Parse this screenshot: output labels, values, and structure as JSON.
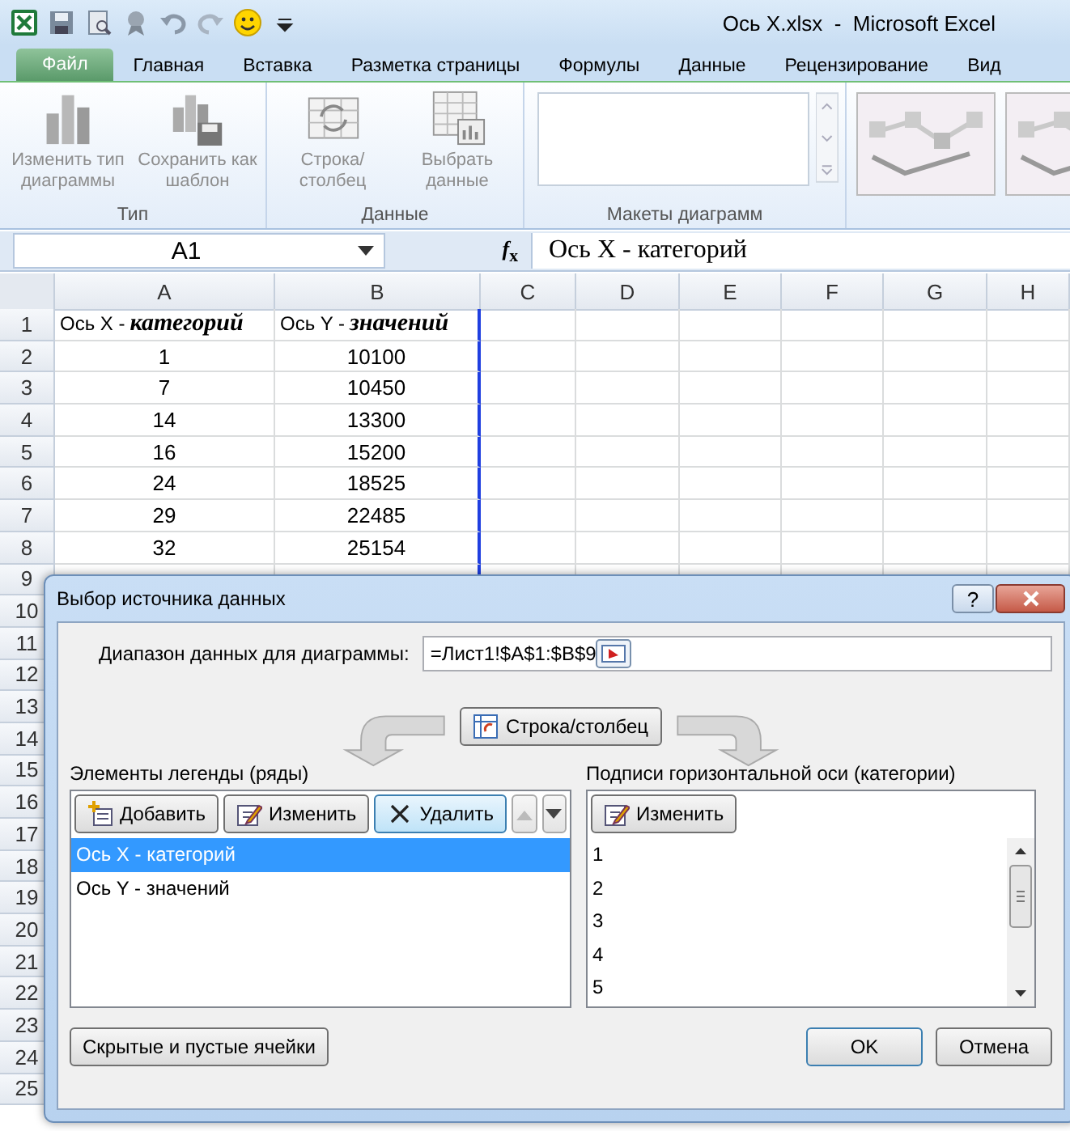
{
  "window": {
    "title": "Ось X.xlsx  -  Microsoft Excel"
  },
  "ribbon_tabs": [
    {
      "label": "Файл",
      "kind": "file",
      "selected": false
    },
    {
      "label": "Главная",
      "kind": "tab",
      "selected": false
    },
    {
      "label": "Вставка",
      "kind": "tab",
      "selected": false
    },
    {
      "label": "Разметка страницы",
      "kind": "tab",
      "selected": false
    },
    {
      "label": "Формулы",
      "kind": "tab",
      "selected": false
    },
    {
      "label": "Данные",
      "kind": "tab",
      "selected": false
    },
    {
      "label": "Рецензирование",
      "kind": "tab",
      "selected": false
    },
    {
      "label": "Вид",
      "kind": "tab",
      "selected": false
    }
  ],
  "ribbon_groups": [
    {
      "label": "Тип",
      "kind": "buttons",
      "buttons": [
        {
          "label": "Изменить тип диаграммы",
          "disabled": true
        },
        {
          "label": "Сохранить как шаблон",
          "disabled": true
        }
      ]
    },
    {
      "label": "Данные",
      "kind": "buttons",
      "buttons": [
        {
          "label": "Строка/столбец",
          "disabled": true
        },
        {
          "label": "Выбрать данные",
          "disabled": true
        }
      ]
    },
    {
      "label": "Макеты диаграмм",
      "kind": "gallery"
    },
    {
      "kind": "styles"
    }
  ],
  "name_box": {
    "value": "A1"
  },
  "formula_bar": {
    "function_button": "*f*$_{x}$",
    "value": "Ось X - категорий"
  },
  "sheet": {
    "columns": [
      "A",
      "B",
      "C",
      "D",
      "E",
      "F",
      "G",
      "H"
    ],
    "rows": [
      {
        "number": "1",
        "cells": [
          "Ось X - **категорий**",
          "Ось Y - **значений**"
        ]
      },
      {
        "number": "2",
        "cells": [
          "1",
          "10100"
        ]
      },
      {
        "number": "3",
        "cells": [
          "7",
          "10450"
        ]
      },
      {
        "number": "4",
        "cells": [
          "14",
          "13300"
        ]
      },
      {
        "number": "5",
        "cells": [
          "16",
          "15200"
        ]
      },
      {
        "number": "6",
        "cells": [
          "24",
          "18525"
        ]
      },
      {
        "number": "7",
        "cells": [
          "29",
          "22485"
        ]
      },
      {
        "number": "8",
        "cells": [
          "32",
          "25154"
        ]
      },
      {
        "number": "9",
        "cells": []
      },
      {
        "number": "10",
        "cells": []
      },
      {
        "number": "11",
        "cells": []
      },
      {
        "number": "12",
        "cells": []
      },
      {
        "number": "13",
        "cells": []
      },
      {
        "number": "14",
        "cells": []
      },
      {
        "number": "15",
        "cells": []
      },
      {
        "number": "16",
        "cells": []
      },
      {
        "number": "17",
        "cells": []
      },
      {
        "number": "18",
        "cells": []
      },
      {
        "number": "19",
        "cells": []
      },
      {
        "number": "20",
        "cells": []
      },
      {
        "number": "21",
        "cells": []
      },
      {
        "number": "22",
        "cells": []
      },
      {
        "number": "23",
        "cells": []
      },
      {
        "number": "24",
        "cells": []
      },
      {
        "number": "25",
        "cells": []
      }
    ]
  },
  "dialog": {
    "title": "Выбор источника данных",
    "help_button": "?",
    "range_label": "Диапазон данных для диаграммы:",
    "range_value": "=Лист1!$A$1:$B$9",
    "switch_button": "Строка/столбец",
    "legend": {
      "label": "Элементы легенды (ряды)",
      "buttons": [
        {
          "label": "Добавить",
          "hovered": false
        },
        {
          "label": "Изменить",
          "hovered": false
        },
        {
          "label": "Удалить",
          "hovered": true
        }
      ],
      "items": [
        {
          "label": "Ось X - категорий",
          "selected": true
        },
        {
          "label": "Ось Y - значений",
          "selected": false
        }
      ]
    },
    "axis": {
      "label": "Подписи горизонтальной оси (категории)",
      "button": "Изменить",
      "items": [
        "1",
        "2",
        "3",
        "4",
        "5"
      ]
    },
    "hidden_button": "Скрытые и пустые ячейки",
    "ok_button": "OK",
    "cancel_button": "Отмена"
  }
}
